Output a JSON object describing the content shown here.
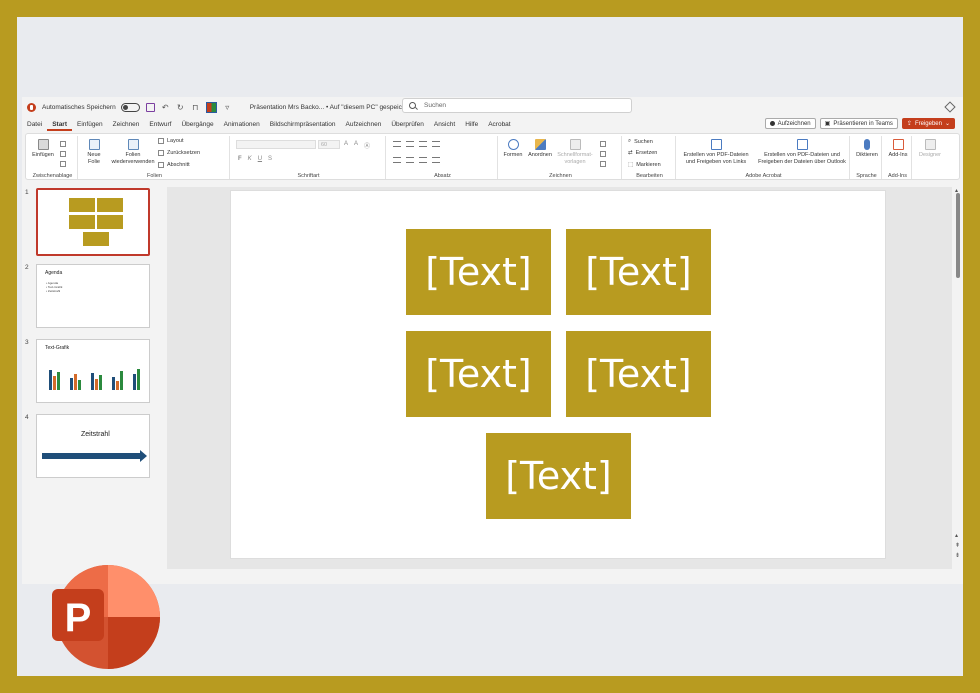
{
  "titlebar": {
    "autosave_label": "Automatisches Speichern",
    "title": "Präsentation Mrs Backo... • Auf \"diesem PC\" gespeichert ⌄",
    "search_placeholder": "Suchen"
  },
  "tabs": [
    "Datei",
    "Start",
    "Einfügen",
    "Zeichnen",
    "Entwurf",
    "Übergänge",
    "Animationen",
    "Bildschirmpräsentation",
    "Aufzeichnen",
    "Überprüfen",
    "Ansicht",
    "Hilfe",
    "Acrobat"
  ],
  "active_tab": "Start",
  "tab_buttons": {
    "record": "Aufzeichnen",
    "teams": "Präsentieren in Teams",
    "share": "Freigeben"
  },
  "ribbon": {
    "clipboard": {
      "paste": "Einfügen",
      "label": "Zwischenablage"
    },
    "slides": {
      "new_slide": "Neue Folie",
      "reuse": "Folien wiederverwenden",
      "layout": "Layout",
      "reset": "Zurücksetzen",
      "section": "Abschnitt",
      "label": "Folien"
    },
    "font": {
      "size": "60",
      "label": "Schriftart",
      "bold": "F",
      "italic": "K",
      "underline": "U",
      "strike": "S"
    },
    "paragraph": {
      "label": "Absatz"
    },
    "drawing": {
      "shapes": "Formen",
      "arrange": "Anordnen",
      "quick_styles": "Schnellformat-vorlagen",
      "label": "Zeichnen"
    },
    "editing": {
      "find": "Suchen",
      "replace": "Ersetzen",
      "select": "Markieren",
      "label": "Bearbeiten"
    },
    "acrobat": {
      "create_pdf": "Erstellen von PDF-Dateien und Freigeben von Links",
      "create_pdf_outlook": "Erstellen von PDF-Dateien und Freigeben der Dateien über Outlook",
      "label": "Adobe Acrobat"
    },
    "voice": {
      "dictate": "Diktieren",
      "label": "Sprache"
    },
    "addins": {
      "addins": "Add-Ins",
      "label": "Add-Ins"
    },
    "designer": {
      "designer": "Designer"
    }
  },
  "thumbnails": [
    {
      "number": "1"
    },
    {
      "number": "2",
      "title": "Agenda",
      "bullets": [
        "Agenda",
        "Text-Grafik",
        "Zeitstrahl"
      ]
    },
    {
      "number": "3",
      "title": "Text-Grafik"
    },
    {
      "number": "4",
      "title": "Zeitstrahl"
    }
  ],
  "slide": {
    "boxes": [
      "[Text]",
      "[Text]",
      "[Text]",
      "[Text]",
      "[Text]"
    ]
  },
  "colors": {
    "accent": "#b89b20",
    "brand": "#c43e1c",
    "arrow": "#1f4e79"
  }
}
